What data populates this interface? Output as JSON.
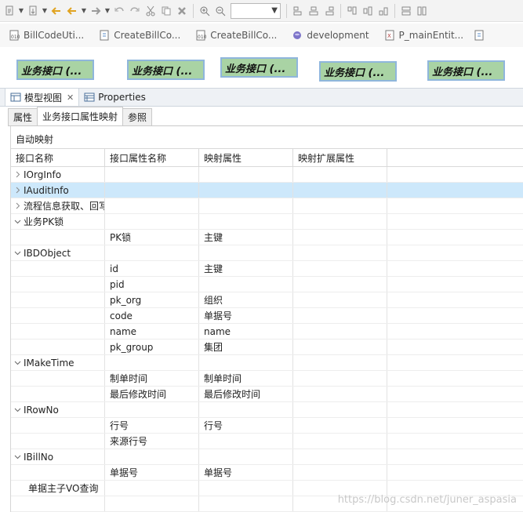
{
  "editor_tabs": [
    {
      "label": "BillCodeUti...",
      "icon": "java-class-file-icon"
    },
    {
      "label": "CreateBillCo...",
      "icon": "java-source-file-icon"
    },
    {
      "label": "CreateBillCo...",
      "icon": "java-class-file-icon"
    },
    {
      "label": "development",
      "icon": "database-icon"
    },
    {
      "label": "P_mainEntit...",
      "icon": "xml-file-icon"
    }
  ],
  "diagram": {
    "boxes": [
      "业务接口 (...",
      "业务接口 (...",
      "业务接口 (...",
      "业务接口 (...",
      "业务接口 (..."
    ],
    "fill_color": "#a9d3a4",
    "border_color": "#8fb6dc"
  },
  "view_tabs": [
    {
      "label": "模型视图",
      "icon": "model-view-icon",
      "active": true,
      "close": "✕"
    },
    {
      "label": "Properties",
      "icon": "properties-icon",
      "active": false
    }
  ],
  "sub_tabs": [
    {
      "label": "属性",
      "active": false
    },
    {
      "label": "业务接口属性映射",
      "active": true
    },
    {
      "label": "参照",
      "active": false
    }
  ],
  "auto_map_label": "自动映射",
  "table": {
    "headers": [
      "接口名称",
      "接口属性名称",
      "映射属性",
      "映射扩展属性"
    ],
    "rows": [
      {
        "name": "IOrgInfo",
        "twisty": "collapsed",
        "attr": "",
        "map": ""
      },
      {
        "name": "IAuditInfo",
        "twisty": "collapsed",
        "attr": "",
        "map": "",
        "selected": true
      },
      {
        "name": "流程信息获取、回写",
        "twisty": "collapsed",
        "attr": "",
        "map": ""
      },
      {
        "name": "业务PK锁",
        "twisty": "expanded",
        "attr": "",
        "map": ""
      },
      {
        "name": "",
        "twisty": "none",
        "attr": "PK锁",
        "map": "主键"
      },
      {
        "name": "IBDObject",
        "twisty": "expanded",
        "attr": "",
        "map": ""
      },
      {
        "name": "",
        "twisty": "none",
        "attr": "id",
        "map": "主键"
      },
      {
        "name": "",
        "twisty": "none",
        "attr": "pid",
        "map": ""
      },
      {
        "name": "",
        "twisty": "none",
        "attr": "pk_org",
        "map": "组织"
      },
      {
        "name": "",
        "twisty": "none",
        "attr": "code",
        "map": "单据号"
      },
      {
        "name": "",
        "twisty": "none",
        "attr": "name",
        "map": "name"
      },
      {
        "name": "",
        "twisty": "none",
        "attr": "pk_group",
        "map": "集团"
      },
      {
        "name": "IMakeTime",
        "twisty": "expanded",
        "attr": "",
        "map": ""
      },
      {
        "name": "",
        "twisty": "none",
        "attr": "制单时间",
        "map": "制单时间"
      },
      {
        "name": "",
        "twisty": "none",
        "attr": "最后修改时间",
        "map": "最后修改时间"
      },
      {
        "name": "IRowNo",
        "twisty": "expanded",
        "attr": "",
        "map": ""
      },
      {
        "name": "",
        "twisty": "none",
        "attr": "行号",
        "map": "行号"
      },
      {
        "name": "",
        "twisty": "none",
        "attr": "来源行号",
        "map": ""
      },
      {
        "name": "IBillNo",
        "twisty": "expanded",
        "attr": "",
        "map": ""
      },
      {
        "name": "",
        "twisty": "none",
        "attr": "单据号",
        "map": "单据号"
      },
      {
        "name": "单据主子VO查询",
        "twisty": "leaf",
        "attr": "",
        "map": ""
      },
      {
        "name": "",
        "twisty": "none",
        "attr": "",
        "map": ""
      }
    ]
  },
  "watermark": "https://blog.csdn.net/juner_aspasia",
  "colors": {
    "selection": "#cde8fb",
    "tab_bar": "#eef1f5"
  }
}
